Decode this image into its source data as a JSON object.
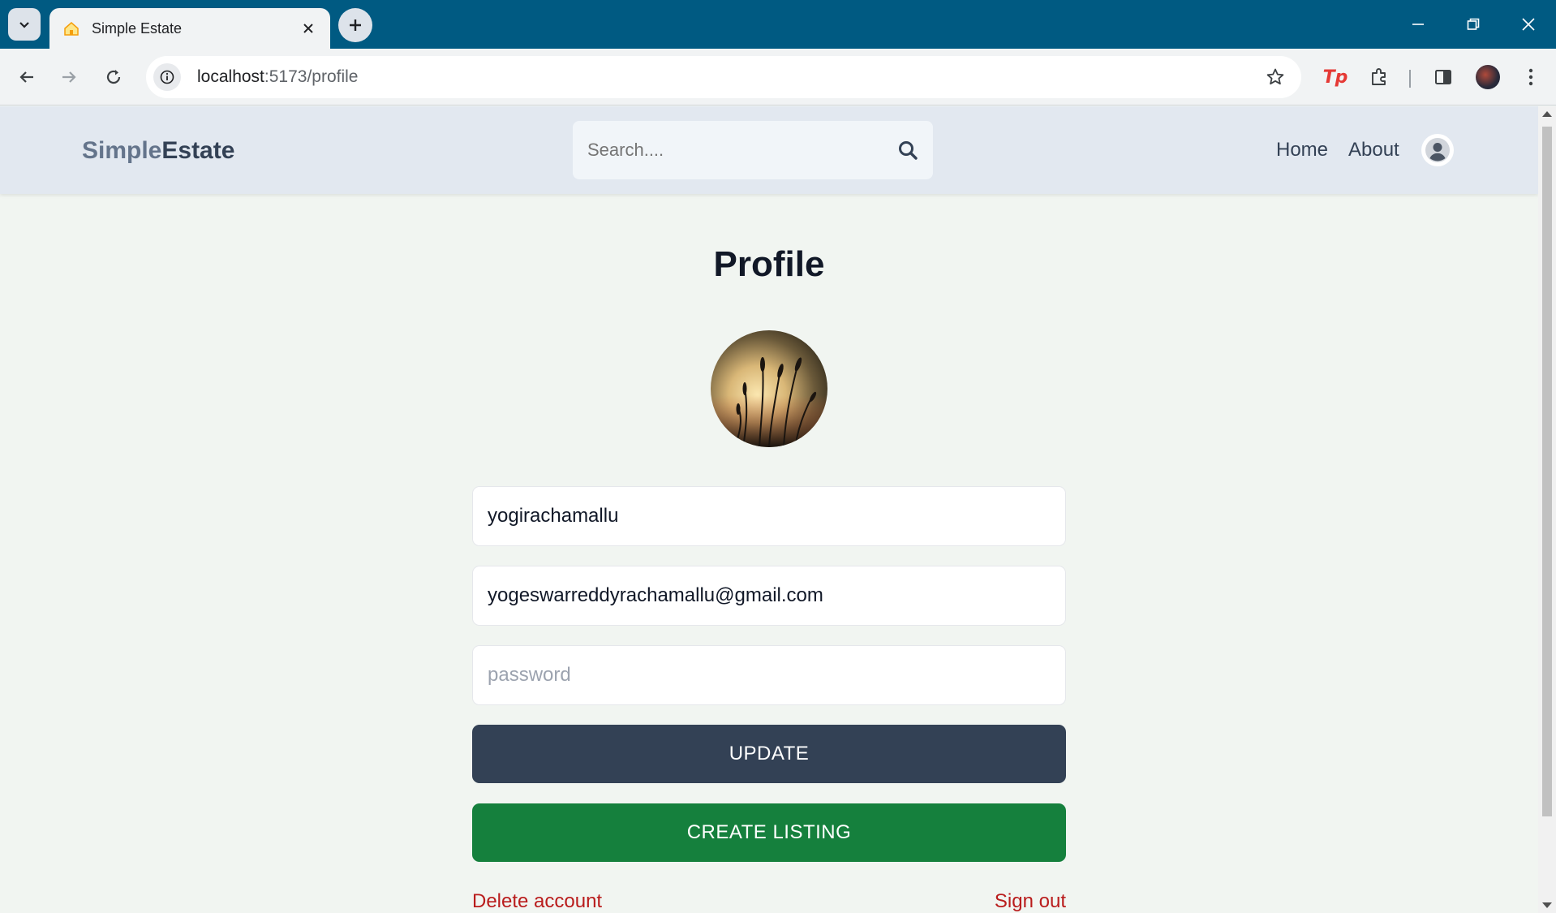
{
  "browser": {
    "tab_title": "Simple Estate",
    "url_host": "localhost",
    "url_path": ":5173/profile",
    "extension_label": "Tp"
  },
  "header": {
    "logo_part1": "Simple",
    "logo_part2": "Estate",
    "search_placeholder": "Search....",
    "nav": {
      "home": "Home",
      "about": "About"
    }
  },
  "profile": {
    "title": "Profile",
    "username": "yogirachamallu",
    "email": "yogeswarreddyrachamallu@gmail.com",
    "password_placeholder": "password",
    "update_label": "UPDATE",
    "create_listing_label": "CREATE LISTING",
    "delete_account_label": "Delete account",
    "sign_out_label": "Sign out"
  },
  "colors": {
    "header_bg": "#e2e8f0",
    "page_bg": "#f1f5f1",
    "update_button": "#334155",
    "create_button": "#15803d",
    "danger_link": "#b91c1c",
    "browser_frame": "#005a82"
  },
  "icons": [
    "tab-search-icon",
    "house-favicon-icon",
    "close-icon",
    "plus-icon",
    "minimize-icon",
    "restore-icon",
    "back-icon",
    "forward-icon",
    "reload-icon",
    "info-icon",
    "star-icon",
    "extensions-icon",
    "side-panel-icon",
    "menu-icon",
    "search-icon",
    "user-icon"
  ]
}
